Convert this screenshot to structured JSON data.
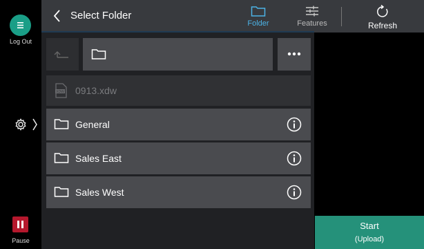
{
  "sidebar": {
    "logout_label": "Log Out",
    "pause_label": "Pause"
  },
  "header": {
    "title": "Select Folder",
    "tabs": [
      {
        "label": "Folder",
        "icon": "folder-icon",
        "active": true
      },
      {
        "label": "Features",
        "icon": "sliders-icon",
        "active": false
      }
    ],
    "refresh_label": "Refresh"
  },
  "browser": {
    "file": {
      "name": "0913.xdw",
      "icon": "xdw-file-icon"
    },
    "folders": [
      {
        "name": "General"
      },
      {
        "name": "Sales East"
      },
      {
        "name": "Sales West"
      }
    ]
  },
  "start": {
    "label": "Start",
    "sub_label": "(Upload)"
  },
  "colors": {
    "accent": "#4cb3e6",
    "logout": "#1a9e87",
    "pause": "#b5182d",
    "start": "#25917a"
  }
}
